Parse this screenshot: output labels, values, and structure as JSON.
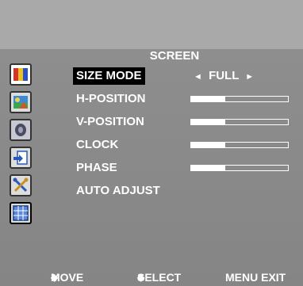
{
  "title": "SCREEN",
  "menu": {
    "items": [
      {
        "label": "SIZE MODE",
        "value": "FULL"
      },
      {
        "label": "H-POSITION",
        "level": 0.35
      },
      {
        "label": "V-POSITION",
        "level": 0.35
      },
      {
        "label": "CLOCK",
        "level": 0.35
      },
      {
        "label": "PHASE",
        "level": 0.35
      },
      {
        "label": "AUTO ADJUST"
      }
    ]
  },
  "footer": {
    "move": "MOVE",
    "select": "SELECT",
    "menu_exit": "MENU EXIT"
  },
  "arrows": {
    "left": "◄",
    "right": "►",
    "diamond": "◆"
  },
  "sidebar_icons": [
    "color-bars-icon",
    "picture-icon",
    "sound-icon",
    "input-icon",
    "tools-icon",
    "screen-icon"
  ]
}
